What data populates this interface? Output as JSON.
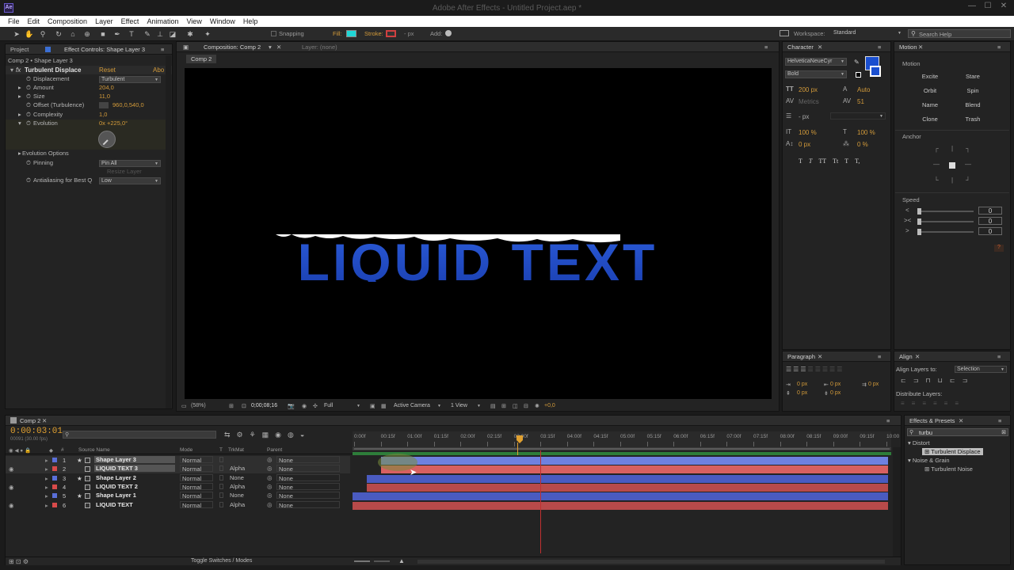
{
  "app": {
    "logo": "Ae",
    "title": "Adobe After Effects - Untitled Project.aep *"
  },
  "window_buttons": [
    "—",
    "☐",
    "✕"
  ],
  "menu": [
    "File",
    "Edit",
    "Composition",
    "Layer",
    "Effect",
    "Animation",
    "View",
    "Window",
    "Help"
  ],
  "toolbar": {
    "snapping": "Snapping",
    "fill": "Fill:",
    "stroke": "Stroke:",
    "px": "- px",
    "add": "Add:",
    "workspace_label": "Workspace:",
    "workspace_value": "Standard",
    "search_placeholder": "Search Help",
    "fill_color": "#1fd6d6",
    "stroke_color": "#d04040"
  },
  "left_panel": {
    "tab_project": "Project",
    "tab_effect": "Effect Controls: Shape Layer 3",
    "breadcrumb": "Comp 2 • Shape Layer 3",
    "effect_name": "Turbulent Displace",
    "reset": "Reset",
    "about": "Abo",
    "props": [
      {
        "name": "Displacement",
        "dropdown": "Turbulent"
      },
      {
        "name": "Amount",
        "value": "204,0"
      },
      {
        "name": "Size",
        "value": "11,0"
      },
      {
        "name": "Offset (Turbulence)",
        "value": "960,0,540,0"
      },
      {
        "name": "Complexity",
        "value": "1,0"
      },
      {
        "name": "Evolution",
        "value": "0x +225,0°"
      }
    ],
    "evolution_options": "Evolution Options",
    "pinning": "Pinning",
    "pinning_value": "Pin All",
    "resize_layer": "Resize Layer",
    "antialias": "Antialiasing for Best Q",
    "antialias_value": "Low"
  },
  "comp_panel": {
    "tab": "Composition: Comp 2",
    "layer_tab": "Layer: (none)",
    "subtab": "Comp 2",
    "canvas_text": "LIQUID TEXT",
    "footer": {
      "zoom": "(58%)",
      "time": "0;00;08;16",
      "quality": "Full",
      "camera": "Active Camera",
      "view": "1 View",
      "exposure": "+0,0"
    }
  },
  "character": {
    "tab": "Character",
    "font": "HelveticaNeueCyr",
    "style": "Bold",
    "size": "200 px",
    "leading": "Auto",
    "kerning": "Metrics",
    "tracking": "51",
    "stroke_px": "- px",
    "vscale": "100 %",
    "hscale": "100 %",
    "baseline": "0 px",
    "tsume": "0 %",
    "styles": [
      "T",
      "T",
      "TT",
      "Tt",
      "T",
      "T,"
    ]
  },
  "motion": {
    "tab": "Motion",
    "section": "Motion",
    "buttons": [
      "Excite",
      "Stare",
      "Orbit",
      "Spin",
      "Name",
      "Blend",
      "Clone",
      "Trash"
    ],
    "anchor": "Anchor",
    "speed": "Speed",
    "speeds": [
      {
        "icon": "<",
        "value": "0"
      },
      {
        "icon": "><",
        "value": "0"
      },
      {
        "icon": ">",
        "value": "0"
      }
    ],
    "help": "?"
  },
  "paragraph": {
    "tab": "Paragraph",
    "values": [
      "0 px",
      "0 px",
      "0 px",
      "0 px",
      "0 px"
    ]
  },
  "align": {
    "tab": "Align",
    "align_to": "Align Layers to:",
    "align_value": "Selection",
    "distribute": "Distribute Layers:"
  },
  "timeline": {
    "tab": "Comp 2",
    "timecode": "0:00:03:01",
    "fps": "00091 (30.00 fps)",
    "headers": {
      "num": "#",
      "source": "Source Name",
      "mode": "Mode",
      "t": "T",
      "trkmat": "TrkMat",
      "parent": "Parent"
    },
    "layers": [
      {
        "num": "1",
        "name": "Shape Layer 3",
        "mode": "Normal",
        "trkmat": "",
        "parent": "None",
        "color": "#5a6fd8",
        "star": "★",
        "selected": true
      },
      {
        "num": "2",
        "name": "LIQUID TEXT 3",
        "mode": "Normal",
        "trkmat": "Alpha",
        "parent": "None",
        "color": "#d84a4a",
        "star": "",
        "selected": true
      },
      {
        "num": "3",
        "name": "Shape Layer 2",
        "mode": "Normal",
        "trkmat": "None",
        "parent": "None",
        "color": "#5a6fd8",
        "star": "★",
        "selected": false
      },
      {
        "num": "4",
        "name": "LIQUID TEXT 2",
        "mode": "Normal",
        "trkmat": "Alpha",
        "parent": "None",
        "color": "#d84a4a",
        "star": "",
        "selected": false
      },
      {
        "num": "5",
        "name": "Shape Layer 1",
        "mode": "Normal",
        "trkmat": "None",
        "parent": "None",
        "color": "#5a6fd8",
        "star": "★",
        "selected": false
      },
      {
        "num": "6",
        "name": "LIQUID TEXT",
        "mode": "Normal",
        "trkmat": "Alpha",
        "parent": "None",
        "color": "#d84a4a",
        "star": "",
        "selected": false
      }
    ],
    "ruler": [
      "0:00f",
      "00:15f",
      "01:00f",
      "01:15f",
      "02:00f",
      "02:15f",
      "03:00f",
      "03:15f",
      "04:00f",
      "04:15f",
      "05:00f",
      "05:15f",
      "06:00f",
      "06:15f",
      "07:00f",
      "07:15f",
      "08:00f",
      "08:15f",
      "09:00f",
      "09:15f",
      "10:00"
    ],
    "toggle": "Toggle Switches / Modes"
  },
  "effects_presets": {
    "tab": "Effects & Presets",
    "search": "turbu",
    "tree": [
      {
        "label": "Distort",
        "type": "folder"
      },
      {
        "label": "Turbulent Displace",
        "type": "item",
        "selected": true
      },
      {
        "label": "Noise & Grain",
        "type": "folder"
      },
      {
        "label": "Turbulent Noise",
        "type": "item",
        "selected": false
      }
    ]
  }
}
